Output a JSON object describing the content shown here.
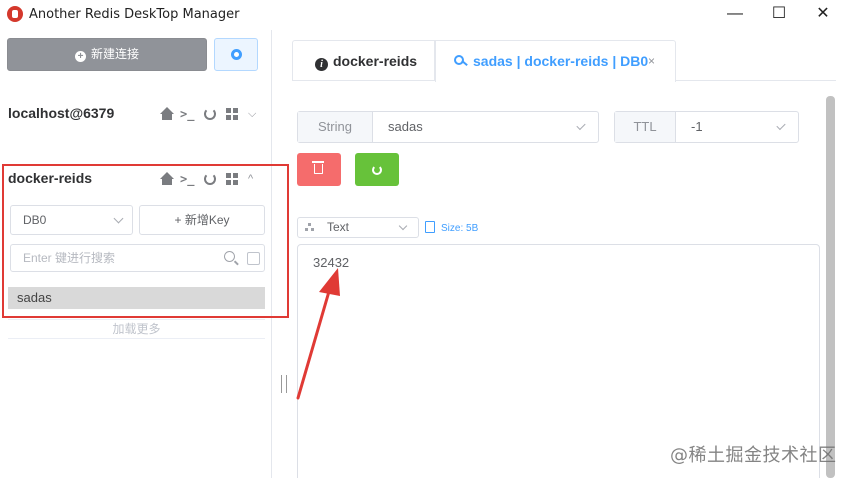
{
  "window": {
    "title": "Another Redis DeskTop Manager",
    "minimize_glyph": "—",
    "maximize_glyph": "☐",
    "close_glyph": "✕"
  },
  "sidebar": {
    "new_connection_label": "新建连接",
    "connections": [
      {
        "name": "localhost@6379",
        "expanded": false,
        "chevron": "⌵"
      },
      {
        "name": "docker-reids",
        "expanded": true,
        "chevron": "^"
      }
    ],
    "terminal_glyph": ">_",
    "db_select": {
      "value": "DB0"
    },
    "new_key_label": "+ 新增Key",
    "search": {
      "placeholder": "Enter 键进行搜索",
      "value": ""
    },
    "keys": [
      "sadas"
    ],
    "load_more_label": "加载更多"
  },
  "tabs": [
    {
      "label": "docker-reids",
      "active": false,
      "icon": "info-icon"
    },
    {
      "label": "sadas | docker-reids | DB0",
      "active": true,
      "icon": "key-icon",
      "close_glyph": "×"
    }
  ],
  "key_detail": {
    "type_label": "String",
    "key_name": "sadas",
    "ttl_label": "TTL",
    "ttl_value": "-1",
    "view_mode": "Text",
    "size_text": "Size: 5B",
    "value": "32432"
  },
  "watermark": "@稀土掘金技术社区",
  "colors": {
    "annotation_red": "#e03a35",
    "primary_blue": "#409eff",
    "delete_red": "#f56c6c",
    "refresh_green": "#67c23a",
    "gray_button": "#909399"
  }
}
